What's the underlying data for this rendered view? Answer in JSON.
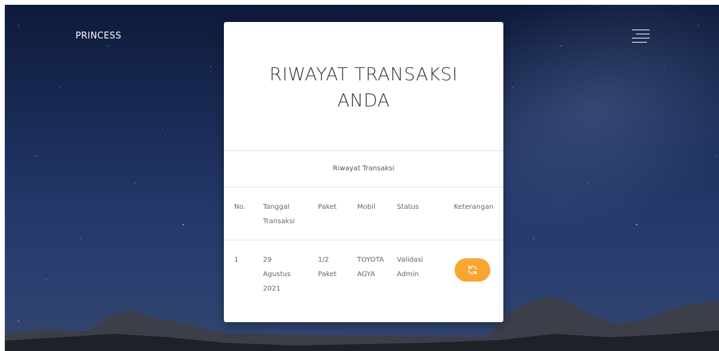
{
  "brand": "PRINCESS",
  "menu_icon": "hamburger-menu-icon",
  "card": {
    "title": "RIWAYAT TRANSAKSI ANDA",
    "title_line1": "RIWAYAT TRANSAKSI",
    "title_line2": "ANDA",
    "caption": "Riwayat Transaksi"
  },
  "table": {
    "headers": {
      "no": "No.",
      "tanggal_1": "Tanggal",
      "tanggal_2": "Transaksi",
      "paket": "Paket",
      "mobil": "Mobil",
      "status": "Status",
      "keterangan": "Keterangan"
    },
    "rows": [
      {
        "no": "1",
        "tanggal": [
          "29",
          "Agustus",
          "2021"
        ],
        "paket": [
          "1/2",
          "Paket"
        ],
        "mobil": [
          "TOYOTA",
          "AGYA"
        ],
        "status": [
          "Validasi",
          "Admin"
        ],
        "keterangan_icon": "refresh-icon"
      }
    ]
  },
  "colors": {
    "accent": "#f9a631",
    "card_bg": "#ffffff",
    "text": "#666666",
    "title": "#333333"
  }
}
